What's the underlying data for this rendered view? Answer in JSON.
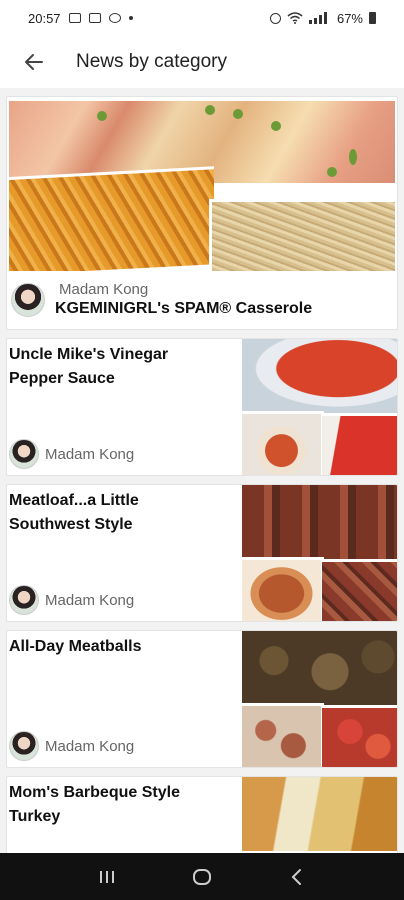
{
  "status_bar": {
    "time": "20:57",
    "battery": "67%"
  },
  "app_bar": {
    "title": "News by category",
    "back_icon": "arrow-left-icon"
  },
  "feed": {
    "featured": {
      "author": "Madam Kong",
      "title": "KGEMINIGRL's SPAM® Casserole"
    },
    "items": [
      {
        "title": "Uncle Mike's Vinegar Pepper Sauce",
        "author": "Madam Kong"
      },
      {
        "title": "Meatloaf...a Little Southwest Style",
        "author": "Madam Kong"
      },
      {
        "title": "All-Day Meatballs",
        "author": "Madam Kong"
      },
      {
        "title": "Mom's Barbeque Style Turkey",
        "author": ""
      }
    ]
  },
  "nav_bar": {
    "recent_icon": "recent-apps-icon",
    "home_icon": "home-icon",
    "back_icon": "back-icon"
  },
  "colors": {
    "background": "#f2f2f2",
    "nav_bar": "#111111",
    "text": "#222222",
    "muted_text": "#666666"
  }
}
